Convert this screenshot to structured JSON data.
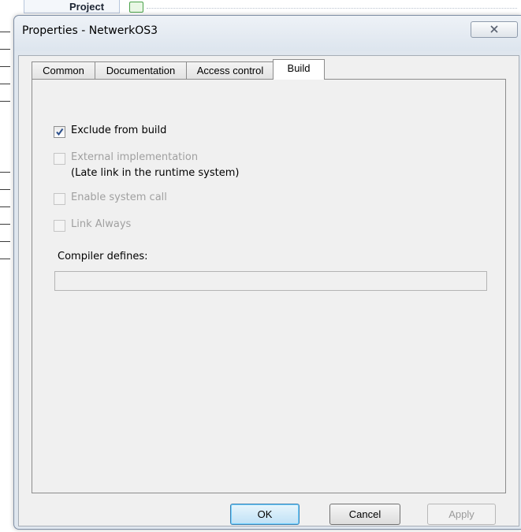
{
  "background": {
    "project_label": "Project"
  },
  "dialog": {
    "title": "Properties - NetwerkOS3",
    "close_icon": "close-icon",
    "tabs": [
      {
        "label": "Common",
        "active": false
      },
      {
        "label": "Documentation",
        "active": false
      },
      {
        "label": "Access control",
        "active": false
      },
      {
        "label": "Build",
        "active": true
      }
    ],
    "build": {
      "exclude_from_build": {
        "label": "Exclude from build",
        "checked": true,
        "enabled": true
      },
      "external_implementation": {
        "label": "External implementation",
        "checked": false,
        "enabled": false
      },
      "external_implementation_note": "(Late link in the runtime system)",
      "enable_system_call": {
        "label": "Enable system call",
        "checked": false,
        "enabled": false
      },
      "link_always": {
        "label": "Link Always",
        "checked": false,
        "enabled": false
      },
      "compiler_defines_label": "Compiler defines:",
      "compiler_defines_value": ""
    },
    "buttons": {
      "ok": "OK",
      "cancel": "Cancel",
      "apply": "Apply"
    }
  },
  "colors": {
    "accent_default_button": "#3c7fb1",
    "dialog_frame": "#dfe6ee",
    "disabled_text": "#a0a0a0"
  }
}
